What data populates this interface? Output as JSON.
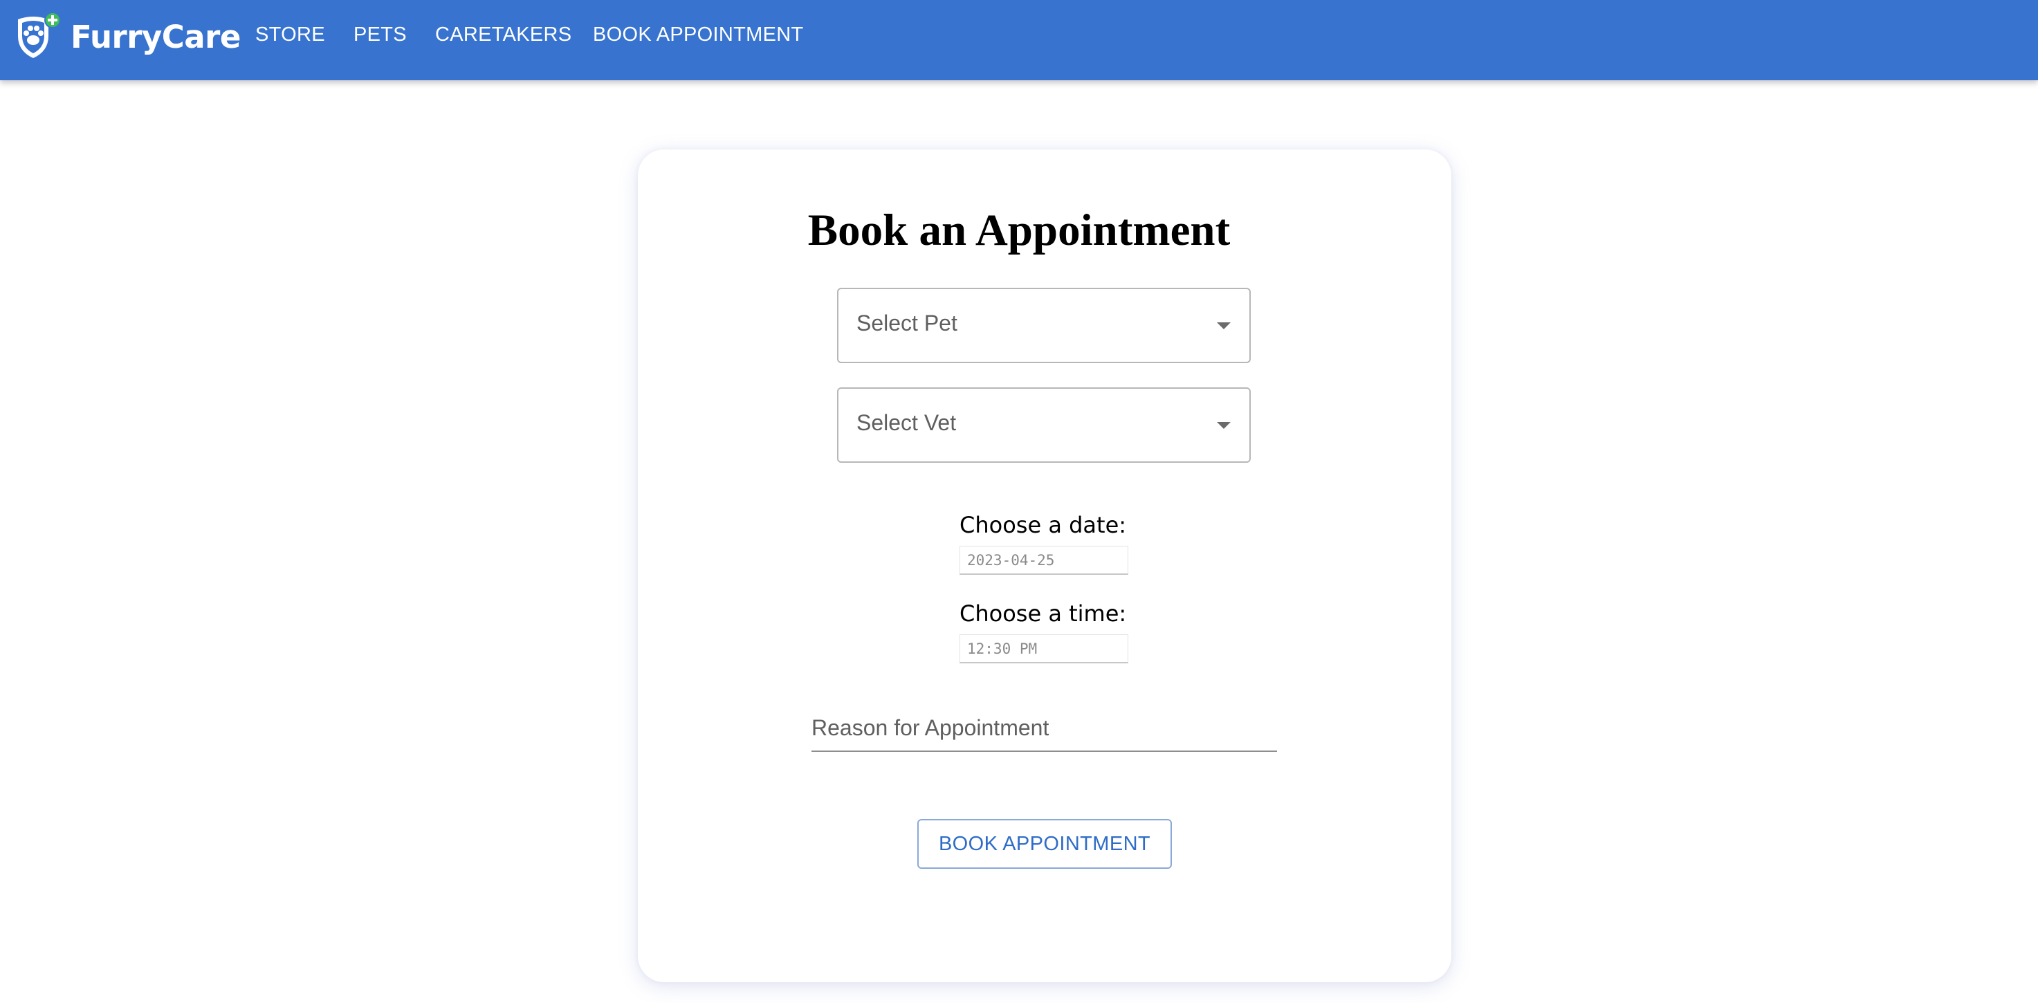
{
  "app": {
    "brand_name": "FurryCare",
    "logo_icon": "shield-paw-plus-icon",
    "accent_color": "#3874cf",
    "logo_badge_color": "#3dbe5a"
  },
  "nav": {
    "items": [
      {
        "label": "STORE"
      },
      {
        "label": "PETS"
      },
      {
        "label": "CARETAKERS"
      },
      {
        "label": "BOOK APPOINTMENT"
      }
    ]
  },
  "form": {
    "title": "Book an Appointment",
    "pet_select": {
      "placeholder": "Select Pet",
      "icon": "dropdown-arrow-icon"
    },
    "vet_select": {
      "placeholder": "Select Vet",
      "icon": "dropdown-arrow-icon"
    },
    "date": {
      "label": "Choose a date:",
      "value": "2023-04-25"
    },
    "time": {
      "label": "Choose a time:",
      "value": "12:30 PM"
    },
    "reason": {
      "placeholder": "Reason for Appointment"
    },
    "submit_label": "BOOK APPOINTMENT"
  }
}
